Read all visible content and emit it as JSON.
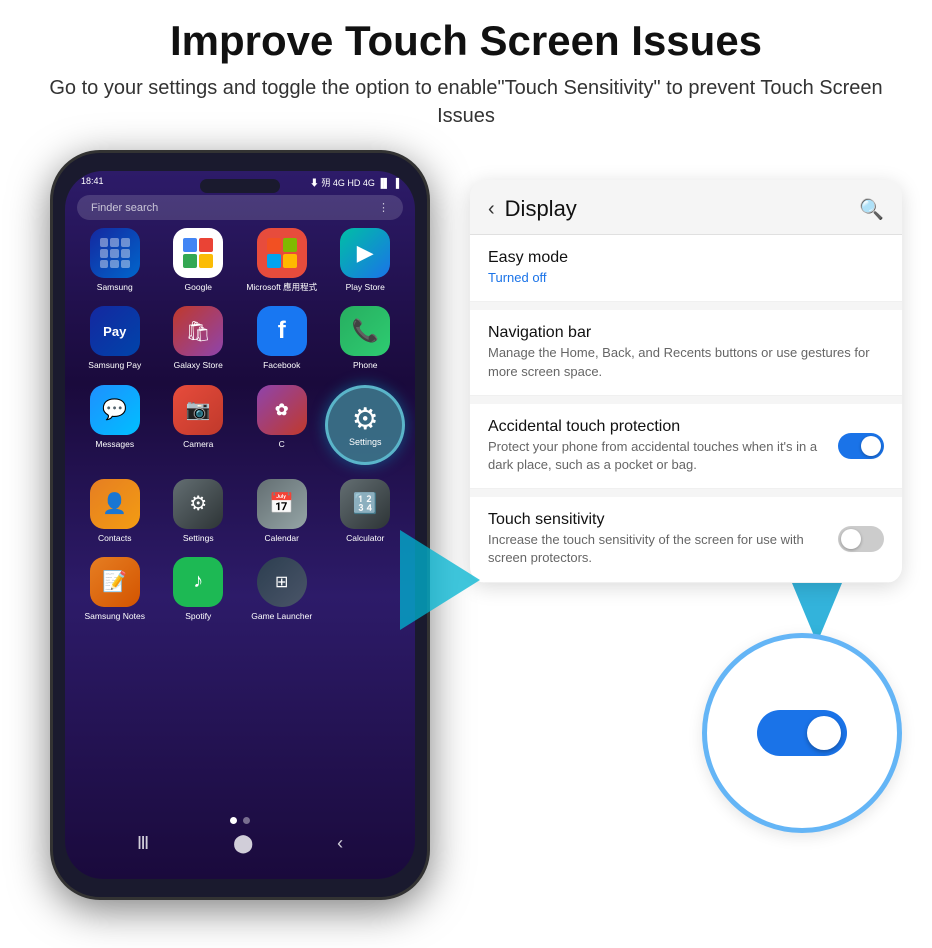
{
  "header": {
    "title": "Improve Touch Screen Issues",
    "subtitle": "Go to your settings and toggle the option to enable\"Touch Sensitivity\" to prevent Touch Screen Issues"
  },
  "phone": {
    "status_bar": {
      "time": "18:41",
      "signal": "⬇ ᵴ⁴⁵ᵍ  ᵃᵘᵗ ⁴ᵍ  ▐▌ ▐"
    },
    "search_placeholder": "Finder search",
    "apps": [
      {
        "label": "Samsung",
        "icon": "samsung"
      },
      {
        "label": "Google",
        "icon": "google"
      },
      {
        "label": "Microsoft 應用程式",
        "icon": "microsoft"
      },
      {
        "label": "Play Store",
        "icon": "playstore"
      },
      {
        "label": "Samsung Pay",
        "icon": "samsungpay"
      },
      {
        "label": "Galaxy Store",
        "icon": "galaxystore"
      },
      {
        "label": "Facebook",
        "icon": "facebook"
      },
      {
        "label": "Phone",
        "icon": "phone"
      },
      {
        "label": "Messages",
        "icon": "messages"
      },
      {
        "label": "Camera",
        "icon": "camera"
      },
      {
        "label": "C",
        "icon": "bixby"
      },
      {
        "label": "Settings",
        "icon": "settings-overlay"
      },
      {
        "label": "Contacts",
        "icon": "contacts"
      },
      {
        "label": "Settings",
        "icon": "settings"
      },
      {
        "label": "Calendar",
        "icon": "calendar"
      },
      {
        "label": "Calculator",
        "icon": "calculator"
      },
      {
        "label": "Samsung Notes",
        "icon": "samsungnotes"
      },
      {
        "label": "Spotify",
        "icon": "spotify"
      },
      {
        "label": "Game Launcher",
        "icon": "gamelauncher"
      }
    ]
  },
  "settings_panel": {
    "title": "Display",
    "items": [
      {
        "id": "easy-mode",
        "title": "Easy mode",
        "subtitle": "Turned off",
        "subtitle_color": "blue",
        "has_toggle": false
      },
      {
        "id": "navigation-bar",
        "title": "Navigation bar",
        "subtitle": "Manage the Home, Back, and Recents buttons or use gestures for more screen space.",
        "has_toggle": false
      },
      {
        "id": "accidental-touch",
        "title": "Accidental touch protection",
        "subtitle": "Protect your phone from accidental touches when it's in a dark place, such as a pocket or bag.",
        "has_toggle": true,
        "toggle_on": true
      },
      {
        "id": "touch-sensitivity",
        "title": "Touch sensitivity",
        "subtitle": "Increase the touch sensitivity of the screen for use with screen protectors.",
        "has_toggle": true,
        "toggle_on": false
      }
    ]
  },
  "icons": {
    "back": "‹",
    "search": "🔍",
    "gear": "⚙",
    "dots": "⋮"
  },
  "colors": {
    "accent": "#1a73e8",
    "teal": "#4fc3f7",
    "brand_blue": "#1428A0"
  }
}
